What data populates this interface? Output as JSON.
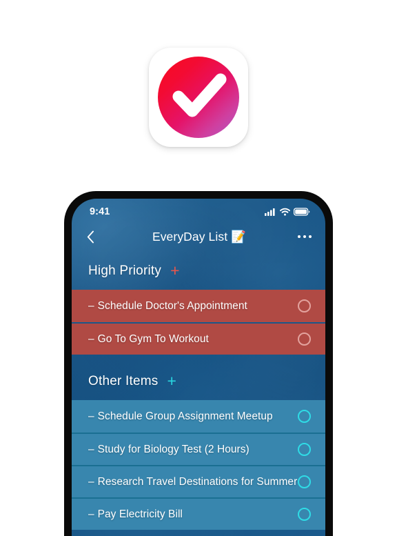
{
  "app_icon": {
    "name": "checkmark-app-icon",
    "gradient_from": "#fa0a1e",
    "gradient_to": "#b05bc8",
    "check_color": "#ffffff",
    "tile_color": "#ffffff"
  },
  "phone": {
    "status_bar": {
      "time": "9:41",
      "icons": [
        "cellular-signal-icon",
        "wifi-icon",
        "battery-icon"
      ]
    },
    "nav": {
      "back_icon": "chevron-left-icon",
      "title": "EveryDay List 📝",
      "more_icon": "more-options-icon"
    },
    "sections": [
      {
        "id": "high-priority",
        "title": "High Priority",
        "add_label": "+",
        "accent": "#e8564c",
        "row_color": "#b04a44",
        "circle_color": "#e3a39e",
        "row_style": "red",
        "circle_style": "circle-pink",
        "items": [
          {
            "dash": "–",
            "label": "Schedule Doctor's Appointment",
            "checked": false
          },
          {
            "dash": "–",
            "label": "Go To Gym To Workout",
            "checked": false
          }
        ]
      },
      {
        "id": "other-items",
        "title": "Other Items",
        "add_label": "+",
        "accent": "#29d6e0",
        "row_color": "#3886ae",
        "circle_color": "#2fdce6",
        "row_style": "teal",
        "circle_style": "circle-cyan",
        "items": [
          {
            "dash": "–",
            "label": "Schedule Group Assignment Meetup",
            "checked": false
          },
          {
            "dash": "–",
            "label": "Study for Biology Test (2 Hours)",
            "checked": false
          },
          {
            "dash": "–",
            "label": "Research Travel Destinations for Summer",
            "checked": false
          },
          {
            "dash": "–",
            "label": "Pay Electricity Bill",
            "checked": false
          }
        ]
      }
    ],
    "background_color": "#1b5788",
    "bezel_color": "#0a0a0a"
  },
  "page": {
    "background_color": "#ffffff"
  }
}
